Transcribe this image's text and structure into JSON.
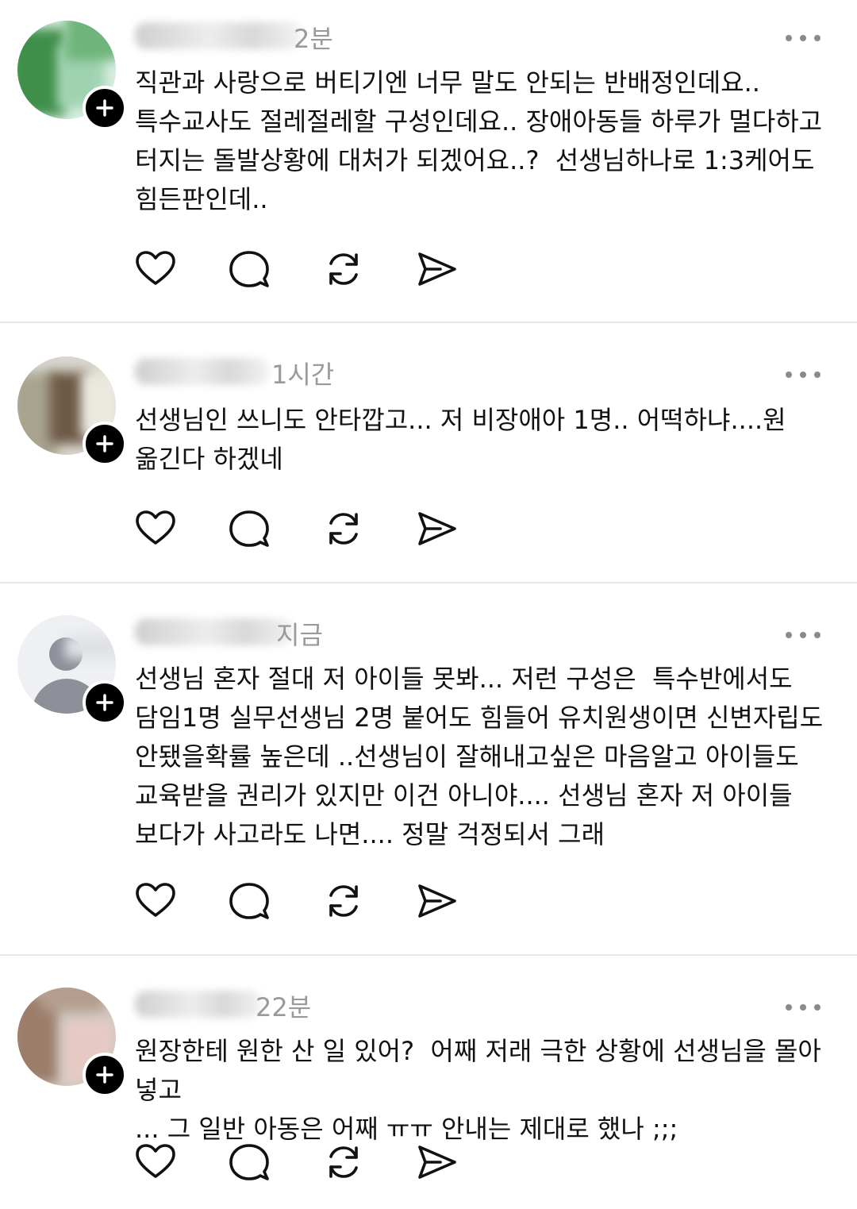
{
  "posts": [
    {
      "time": "2분",
      "text": "직관과 사랑으로 버티기엔 너무 말도 안되는 반배정인데요..\n특수교사도 절레절레할 구성인데요.. 장애아동들 하루가 멀다하고\n터지는 돌발상황에 대처가 되겠어요..?  선생님하나로 1:3케어도\n힘든판인데..",
      "avatar_colors": [
        "#3f8f4a",
        "#9fd3b0",
        "#d9eee0"
      ]
    },
    {
      "time": "1시간",
      "text": "선생님인 쓰니도 안타깝고... 저 비장애아 1명.. 어떡하냐....원\n옮긴다 하겠네",
      "avatar_colors": [
        "#a9a48f",
        "#6d5a46",
        "#d8d6cd"
      ]
    },
    {
      "time": "지금",
      "text": "선생님 혼자 절대 저 아이들 못봐... 저런 구성은  특수반에서도\n담임1명 실무선생님 2명 붙어도 힘들어 유치원생이면 신변자립도\n안됐을확률 높은데 ..선생님이 잘해내고싶은 마음알고 아이들도\n교육받을 권리가 있지만 이건 아니야.... 선생님 혼자 저 아이들\n보다가 사고라도 나면.... 정말 걱정되서 그래",
      "avatar_colors": [
        "#eef0f3",
        "#8d9099",
        "#c9ccd2"
      ]
    },
    {
      "time": "22분",
      "text": "원장한테 원한 산 일 있어?  어째 저래 극한 상황에 선생님을 몰아넣고\n... 그 일반 아동은 어째 ㅠㅠ 안내는 제대로 했나 ;;;",
      "avatar_colors": [
        "#9b7d6a",
        "#e7c9c4",
        "#cfc9c2"
      ]
    }
  ],
  "icons": [
    "heart-icon",
    "comment-icon",
    "repost-icon",
    "share-icon"
  ],
  "colors": {
    "text": "#111111",
    "meta": "#9a9a9a",
    "divider": "#e8e8e8",
    "icon": "#111111"
  }
}
